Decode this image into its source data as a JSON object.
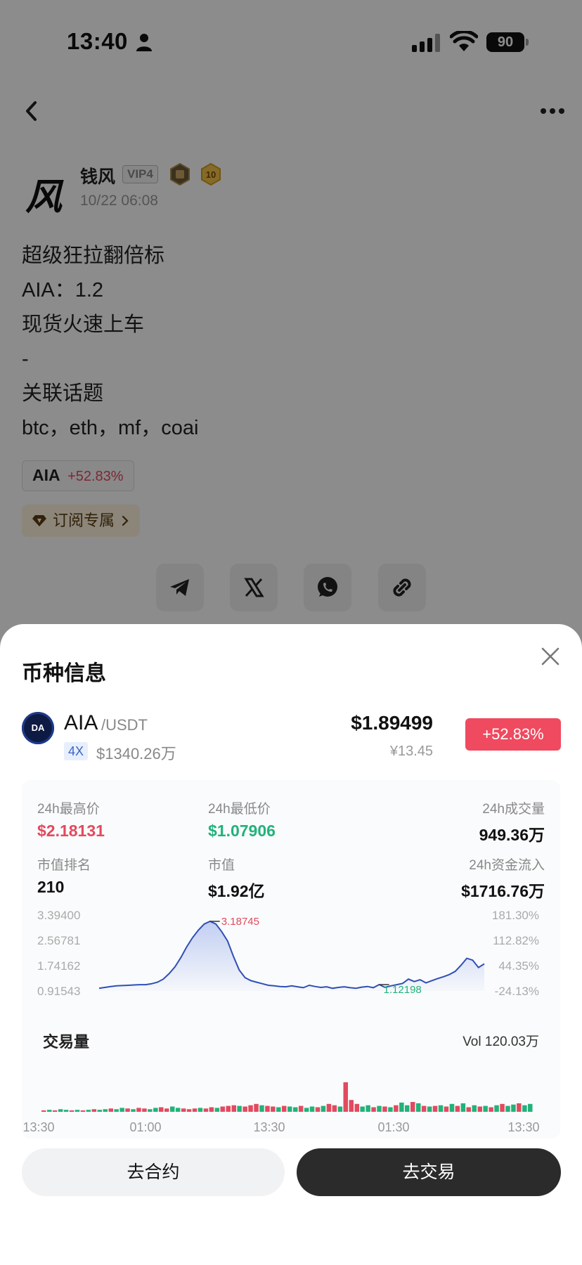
{
  "status_bar": {
    "time": "13:40",
    "battery": "90"
  },
  "author": {
    "avatar_char": "风",
    "name": "钱风",
    "vip": "VIP4",
    "level": "10",
    "time": "10/22 06:08"
  },
  "post": {
    "lines": [
      "超级狂拉翻倍标",
      "AIA：1.2",
      "现货火速上车",
      "-",
      "关联话题",
      "btc，eth，mf，coai"
    ]
  },
  "coin_tag": {
    "name": "AIA",
    "change": "+52.83%"
  },
  "subscribe": {
    "label": "订阅专属"
  },
  "share": {
    "icons": [
      "telegram-icon",
      "x-icon",
      "whatsapp-icon",
      "link-icon"
    ]
  },
  "sheet": {
    "title": "币种信息",
    "coin": {
      "logo_text": "DA",
      "symbol": "AIA",
      "quote": "/USDT",
      "leverage": "4X",
      "market_cap_short": "$1340.26万",
      "price_usd": "$1.89499",
      "price_cny": "¥13.45",
      "change": "+52.83%"
    },
    "stats": {
      "high_label": "24h最高价",
      "high": "$2.18131",
      "low_label": "24h最低价",
      "low": "$1.07906",
      "volume_label": "24h成交量",
      "volume": "949.36万",
      "rank_label": "市值排名",
      "rank": "210",
      "mcap_label": "市值",
      "mcap": "$1.92亿",
      "inflow_label": "24h资金流入",
      "inflow": "$1716.76万"
    },
    "volume_title": "交易量",
    "volume_total": "Vol 120.03万",
    "buttons": {
      "futures": "去合约",
      "trade": "去交易"
    }
  },
  "colors": {
    "up": "#e24a5f",
    "down": "#22b27a",
    "line": "#2f4fb5",
    "badge": "#ef4a5f"
  },
  "chart_data": [
    {
      "type": "line",
      "title": "",
      "y_left_ticks": [
        "3.39400",
        "2.56781",
        "1.74162",
        "0.91543"
      ],
      "y_right_ticks": [
        "181.30%",
        "112.82%",
        "44.35%",
        "-24.13%"
      ],
      "ylim": [
        0.91543,
        3.394
      ],
      "annotations": [
        {
          "label": "3.18745",
          "value": 3.18745
        },
        {
          "label": "1.12198",
          "value": 1.12198
        }
      ],
      "series": [
        {
          "values": [
            1.0,
            1.03,
            1.06,
            1.08,
            1.09,
            1.1,
            1.11,
            1.12,
            1.12,
            1.15,
            1.2,
            1.3,
            1.48,
            1.7,
            2.0,
            2.35,
            2.65,
            2.9,
            3.1,
            3.18745,
            3.1,
            2.85,
            2.55,
            2.05,
            1.6,
            1.35,
            1.25,
            1.2,
            1.15,
            1.1,
            1.08,
            1.06,
            1.05,
            1.08,
            1.05,
            1.02,
            1.1,
            1.06,
            1.03,
            1.05,
            1.0,
            1.03,
            1.05,
            1.02,
            1.0,
            1.04,
            1.06,
            1.02,
            1.12198,
            1.03,
            1.08,
            1.12,
            1.16,
            1.3,
            1.22,
            1.28,
            1.18,
            1.25,
            1.32,
            1.38,
            1.45,
            1.55,
            1.75,
            1.98,
            1.92,
            1.68,
            1.8
          ]
        }
      ]
    },
    {
      "type": "bar",
      "title": "",
      "x_ticks": [
        "13:30",
        "01:00",
        "13:30",
        "01:30",
        "13:30"
      ],
      "series": [
        {
          "values": [
            2,
            3,
            2,
            4,
            3,
            2,
            3,
            2,
            3,
            4,
            3,
            4,
            5,
            4,
            6,
            5,
            4,
            6,
            5,
            4,
            6,
            7,
            5,
            8,
            6,
            5,
            4,
            5,
            6,
            5,
            7,
            6,
            8,
            9,
            10,
            9,
            8,
            10,
            12,
            10,
            9,
            8,
            7,
            9,
            8,
            7,
            9,
            6,
            8,
            7,
            9,
            12,
            10,
            8,
            45,
            18,
            12,
            8,
            10,
            7,
            9,
            8,
            7,
            10,
            14,
            10,
            15,
            13,
            9,
            8,
            9,
            10,
            8,
            12,
            9,
            13,
            7,
            10,
            8,
            9,
            7,
            10,
            12,
            9,
            11,
            13,
            10,
            12
          ],
          "directions": [
            "d",
            "u",
            "d",
            "u",
            "u",
            "d",
            "u",
            "d",
            "u",
            "d",
            "u",
            "u",
            "d",
            "u",
            "u",
            "d",
            "u",
            "d",
            "d",
            "u",
            "u",
            "d",
            "d",
            "u",
            "u",
            "d",
            "d",
            "d",
            "u",
            "d",
            "d",
            "u",
            "d",
            "d",
            "d",
            "u",
            "d",
            "d",
            "d",
            "u",
            "d",
            "d",
            "u",
            "d",
            "u",
            "u",
            "d",
            "u",
            "u",
            "d",
            "u",
            "d",
            "d",
            "u",
            "d",
            "d",
            "d",
            "u",
            "u",
            "d",
            "u",
            "d",
            "u",
            "d",
            "u",
            "u",
            "d",
            "u",
            "d",
            "u",
            "d",
            "u",
            "d",
            "u",
            "d",
            "u",
            "d",
            "u",
            "d",
            "u",
            "d",
            "u",
            "d",
            "u",
            "u",
            "d",
            "u",
            "u"
          ]
        }
      ]
    }
  ]
}
